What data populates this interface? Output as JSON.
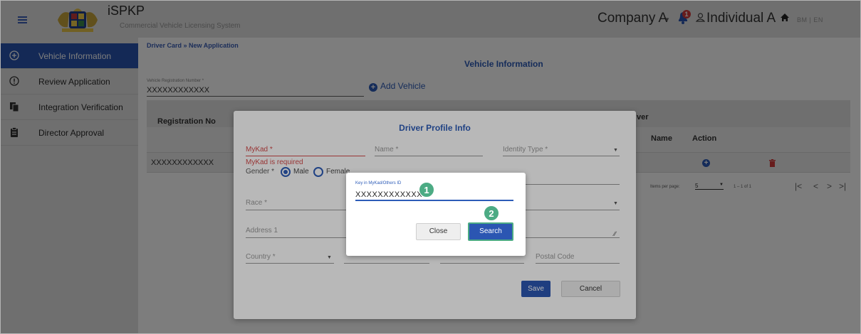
{
  "header": {
    "brand_name": "iSPKP",
    "brand_subtitle": "Commercial Vehicle Licensing System",
    "company": "Company A",
    "notification_count": "1",
    "user": "Individual A",
    "language": "BM | EN"
  },
  "sidebar": {
    "items": [
      {
        "label": "Vehicle Information",
        "icon": "plus-circle-icon",
        "active": true
      },
      {
        "label": "Review Application",
        "icon": "info-circle-icon",
        "active": false
      },
      {
        "label": "Integration Verification",
        "icon": "documents-icon",
        "active": false
      },
      {
        "label": "Director Approval",
        "icon": "clipboard-icon",
        "active": false
      }
    ]
  },
  "main": {
    "breadcrumb": "Driver Card » New Application",
    "section_title": "Vehicle Information",
    "vehicle_reg_label": "Vehicle Registration Number *",
    "vehicle_reg_value": "XXXXXXXXXXXX",
    "add_vehicle": "Add Vehicle",
    "table": {
      "col_registration": "Registration No",
      "col_driver_partial": "ver",
      "col_name": "Name",
      "col_action": "Action",
      "row_registration": "XXXXXXXXXXXX"
    },
    "pager": {
      "items_per_page_label": "Items per page:",
      "items_per_page_value": "5",
      "range": "1 – 1 of 1"
    }
  },
  "driver_dialog": {
    "title": "Driver Profile Info",
    "mykad_label": "MyKad *",
    "mykad_error": "MyKad is required",
    "name_label": "Name *",
    "identity_type_label": "Identity Type *",
    "gender_label": "Gender *",
    "gender_options": [
      "Male",
      "Female"
    ],
    "gender_selected": "Male",
    "race_label": "Race *",
    "address_label": "Address 1",
    "country_label": "Country *",
    "postal_code_label": "Postal Code",
    "save": "Save",
    "cancel": "Cancel"
  },
  "search_dialog": {
    "label": "Key in MyKad/Others ID",
    "value": "XXXXXXXXXXXX",
    "close": "Close",
    "search": "Search",
    "step_1": "1",
    "step_2": "2"
  },
  "colors": {
    "accent_blue": "#2b56b2",
    "step_green": "#4cab84",
    "error_red": "#d34a4a"
  }
}
